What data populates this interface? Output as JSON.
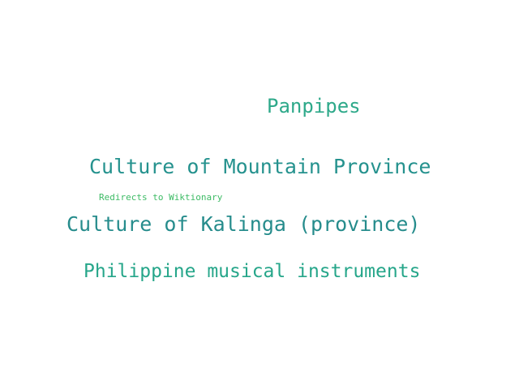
{
  "words": [
    {
      "text": "Panpipes",
      "color": "#2ea98a"
    },
    {
      "text": "Culture of Mountain Province",
      "color": "#25928e"
    },
    {
      "text": "Redirects to Wiktionary",
      "color": "#3dbb65"
    },
    {
      "text": "Culture of Kalinga (province)",
      "color": "#268c8c"
    },
    {
      "text": "Philippine musical instruments",
      "color": "#26a68a"
    }
  ]
}
